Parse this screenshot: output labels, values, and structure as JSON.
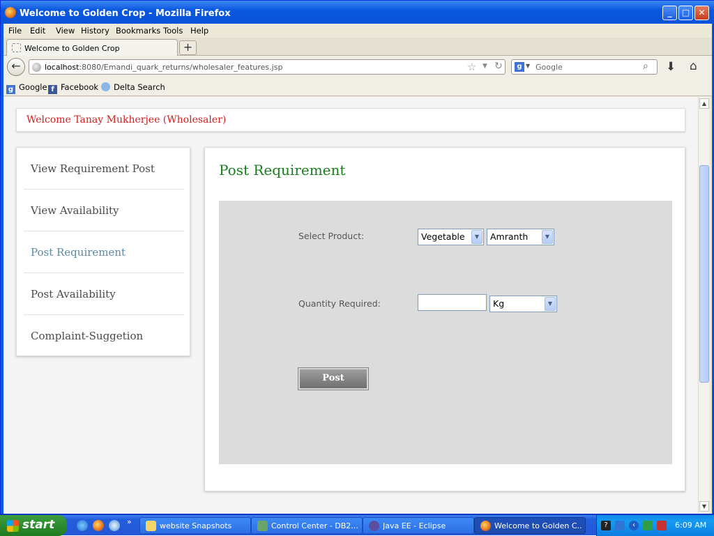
{
  "window": {
    "title": "Welcome to Golden Crop - Mozilla Firefox",
    "minimize": "_",
    "maximize": "□",
    "close": "✕"
  },
  "menu": [
    "File",
    "Edit",
    "View",
    "History",
    "Bookmarks",
    "Tools",
    "Help"
  ],
  "tab": {
    "label": "Welcome to Golden Crop",
    "new_tab": "+"
  },
  "nav": {
    "back": "←",
    "url_host": "localhost",
    "url_rest": ":8080/Emandi_quark_returns/wholesaler_features.jsp",
    "star": "☆",
    "reload": "↻",
    "search_placeholder": "Google",
    "search_engine_icon": "google-icon",
    "download": "⬇",
    "home": "⌂"
  },
  "bookmarks": [
    {
      "label": "Google",
      "icon": "google-icon"
    },
    {
      "label": "Facebook",
      "icon": "facebook-icon"
    },
    {
      "label": "Delta Search",
      "icon": "delta-search-icon"
    }
  ],
  "page": {
    "welcome": "Welcome Tanay Mukherjee (Wholesaler)",
    "sidebar": [
      {
        "label": "View Requirement Post",
        "active": false
      },
      {
        "label": "View Availability",
        "active": false
      },
      {
        "label": "Post Requirement",
        "active": true
      },
      {
        "label": "Post Availability",
        "active": false
      },
      {
        "label": "Complaint-Suggetion",
        "active": false
      }
    ],
    "heading": "Post Requirement",
    "form": {
      "product_label": "Select Product:",
      "category_value": "Vegetable",
      "product_value": "Amranth",
      "quantity_label": "Quantity Required:",
      "quantity_value": "",
      "unit_value": "Kg",
      "submit_label": "Post"
    },
    "colors": {
      "welcome_text": "#d11e1e",
      "heading": "#17801b",
      "active_nav": "#5c8aa3"
    }
  },
  "taskbar": {
    "start": "start",
    "more": "»",
    "buttons": [
      {
        "label": "website Snapshots",
        "icon": "folder-icon",
        "active": false
      },
      {
        "label": "Control Center - DB2...",
        "icon": "db2-icon",
        "active": false
      },
      {
        "label": "Java EE - Eclipse",
        "icon": "eclipse-icon",
        "active": false
      },
      {
        "label": "Welcome to Golden C...",
        "icon": "firefox-icon",
        "active": true
      }
    ],
    "clock": "6:09 AM"
  }
}
